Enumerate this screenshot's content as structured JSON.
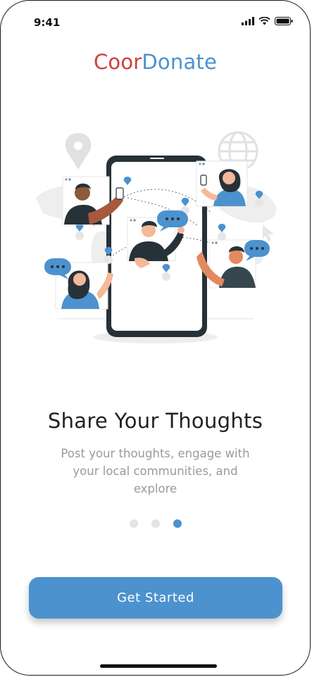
{
  "status_bar": {
    "time": "9:41"
  },
  "brand": {
    "part1": "Coor",
    "part2": "Donate",
    "color_primary": "#d0403a",
    "color_secondary": "#4b92cf"
  },
  "onboarding": {
    "title": "Share Your Thoughts",
    "subtitle": "Post your thoughts, engage with your local communities, and explore",
    "page_count": 3,
    "active_page": 3
  },
  "cta": {
    "label": "Get Started",
    "color": "#4b92cf"
  },
  "icons": [
    "signal-icon",
    "wifi-icon",
    "battery-icon",
    "location-pin-icon",
    "globe-icon",
    "chat-bubble-icon",
    "cursor-icon"
  ]
}
